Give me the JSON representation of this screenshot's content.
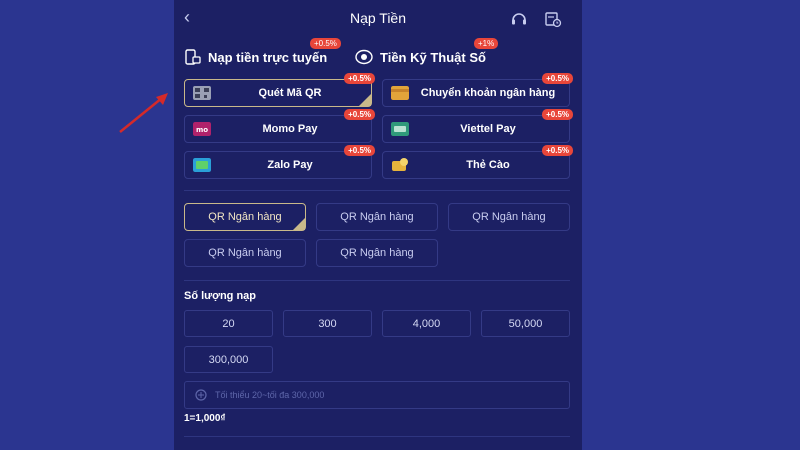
{
  "header": {
    "back_glyph": "‹",
    "title": "Nạp Tiền",
    "icons": [
      "headset-icon",
      "history-icon"
    ]
  },
  "methods": [
    {
      "label": "Nạp tiền trực tuyến",
      "badge": "+0.5%",
      "icon": "phone-card-icon"
    },
    {
      "label": "Tiền Kỹ Thuật Số",
      "badge": "+1%",
      "icon": "coin-icon"
    }
  ],
  "payment_options": [
    {
      "label": "Quét Mã QR",
      "badge": "+0.5%",
      "icon": "qr-code-icon",
      "selected": true
    },
    {
      "label": "Chuyển khoản ngân hàng",
      "badge": "+0.5%",
      "icon": "bank-card-icon",
      "selected": false
    },
    {
      "label": "Momo Pay",
      "badge": "+0.5%",
      "icon": "momo-icon",
      "selected": false
    },
    {
      "label": "Viettel Pay",
      "badge": "+0.5%",
      "icon": "viettel-pay-icon",
      "selected": false
    },
    {
      "label": "Zalo Pay",
      "badge": "+0.5%",
      "icon": "zalo-pay-icon",
      "selected": false
    },
    {
      "label": "Thẻ Cào",
      "badge": "+0.5%",
      "icon": "scratch-card-icon",
      "selected": false
    }
  ],
  "bank_options": [
    {
      "label": "QR Ngân hàng",
      "selected": true
    },
    {
      "label": "QR Ngân hàng",
      "selected": false
    },
    {
      "label": "QR Ngân hàng",
      "selected": false
    },
    {
      "label": "QR Ngân hàng",
      "selected": false
    },
    {
      "label": "QR Ngân hàng",
      "selected": false
    }
  ],
  "amount": {
    "label": "Số lượng nạp",
    "presets": [
      "20",
      "300",
      "4,000",
      "50,000",
      "300,000"
    ],
    "placeholder": "Tối thiểu 20~tối đa 300,000",
    "rate": "1=1,000₫"
  },
  "colors": {
    "background": "#2b3590",
    "panel": "#1c2064",
    "badge": "#e8463a",
    "selected_border": "#c9b98a",
    "annotation_arrow": "#d42a2a"
  }
}
